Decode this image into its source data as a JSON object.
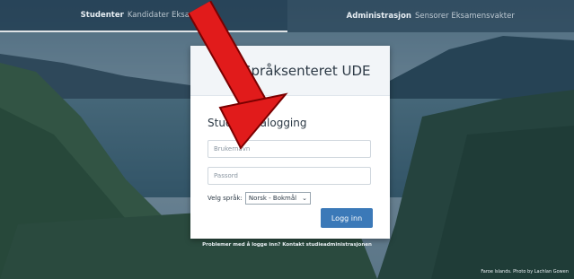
{
  "topbar": {
    "left_strong": "Studenter",
    "left_rest": "Kandidater Eksamen",
    "right_strong": "Administrasjon",
    "right_rest": "Sensorer Eksamensvakter"
  },
  "card": {
    "title": "Språksenteret UDE",
    "login_title": "Student pålogging",
    "username_placeholder": "Brukernavn",
    "password_placeholder": "Passord",
    "language_label": "Velg språk:",
    "language_value": "Norsk - Bokmål",
    "submit_label": "Logg inn"
  },
  "footer": {
    "help_text": "Problemer med å logge inn? Kontakt studieadministrasjonen",
    "photo_credit": "Faroe Islands. Photo by Lachlan Gowen"
  },
  "colors": {
    "accent": "#3b79b8",
    "annotation_arrow": "#e11b1b"
  }
}
